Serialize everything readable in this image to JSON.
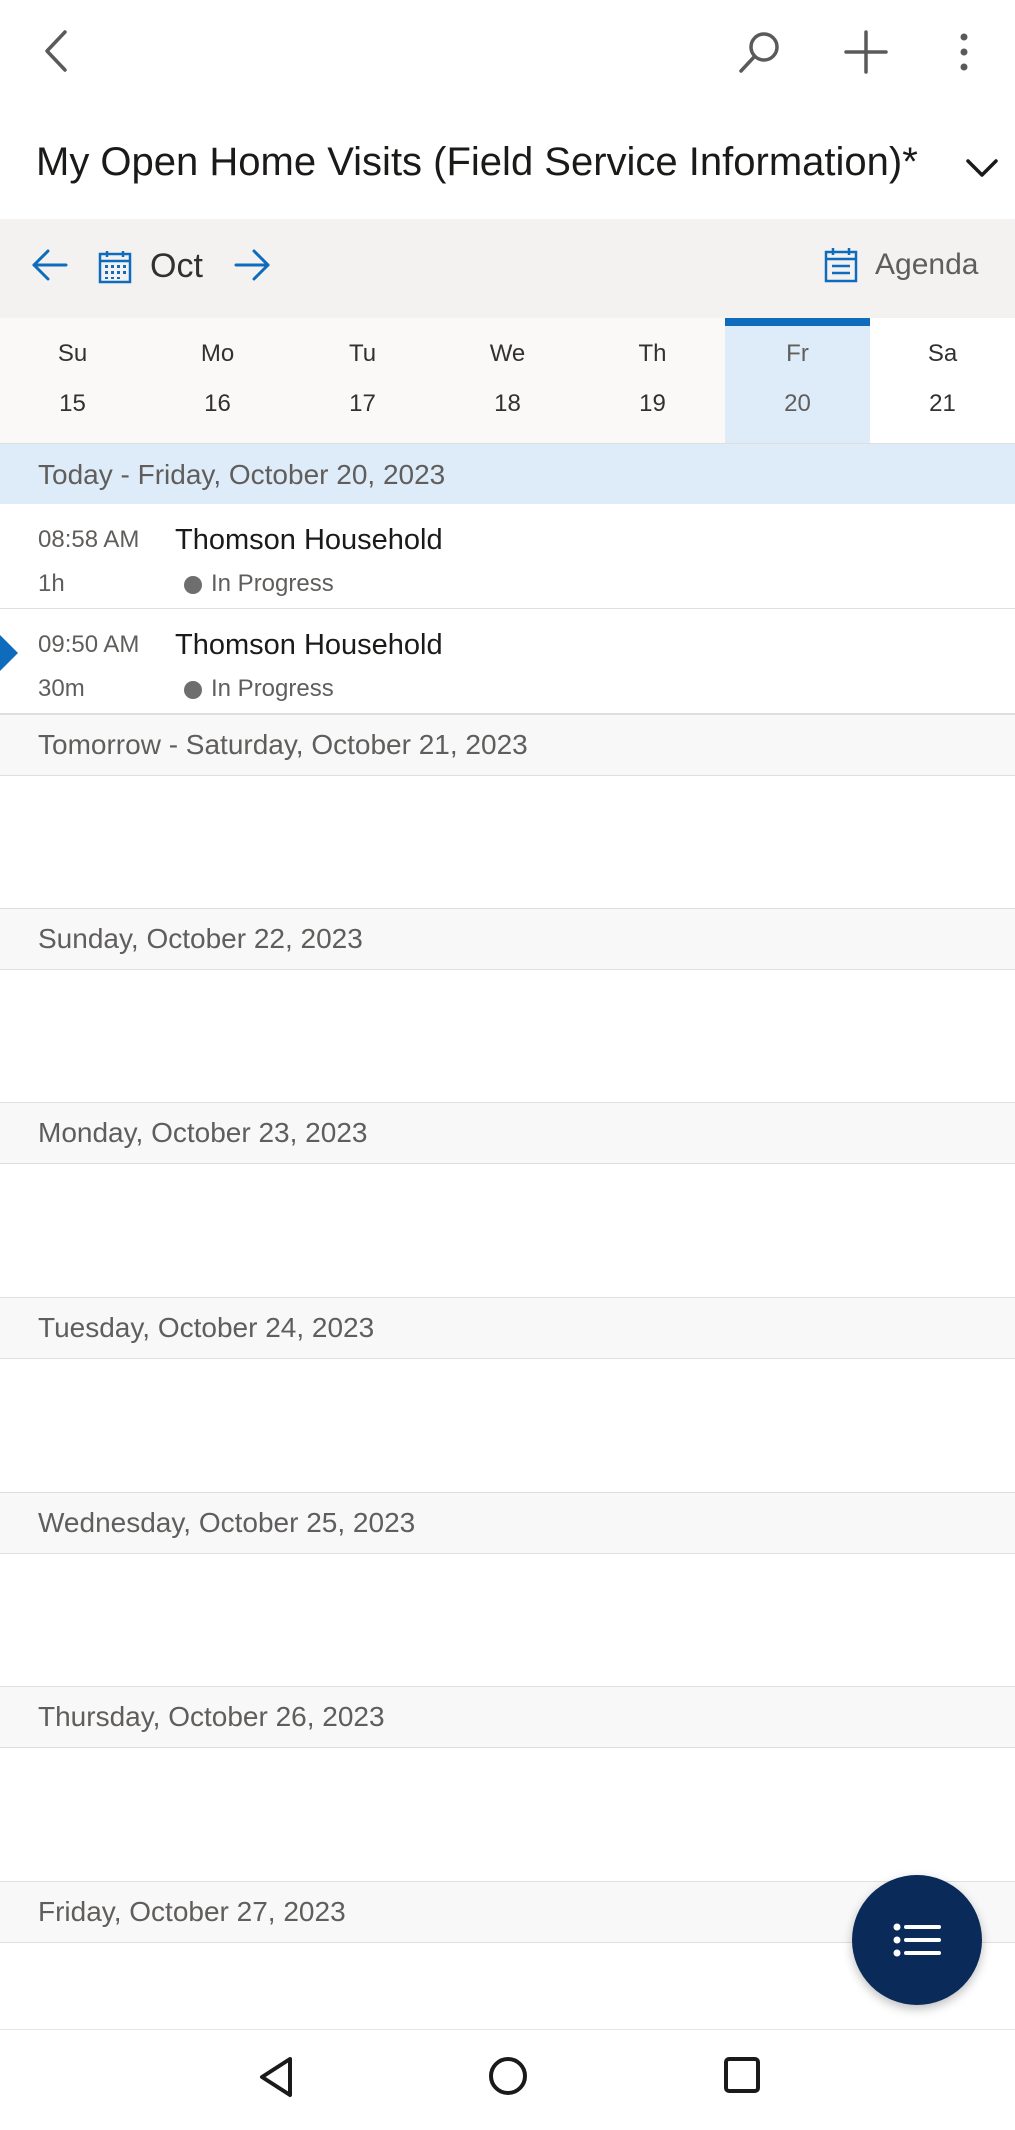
{
  "appbar": {
    "back_icon": "chevron-left-icon",
    "search_icon": "search-icon",
    "add_icon": "plus-icon",
    "more_icon": "more-vertical-icon"
  },
  "view": {
    "title": "My Open Home Visits (Field Service Information)*",
    "chevron_icon": "chevron-down-icon"
  },
  "calendar_nav": {
    "month": "Oct",
    "view_mode": "Agenda"
  },
  "week": [
    {
      "name": "Su",
      "date": "15"
    },
    {
      "name": "Mo",
      "date": "16"
    },
    {
      "name": "Tu",
      "date": "17"
    },
    {
      "name": "We",
      "date": "18"
    },
    {
      "name": "Th",
      "date": "19"
    },
    {
      "name": "Fr",
      "date": "20"
    },
    {
      "name": "Sa",
      "date": "21"
    }
  ],
  "agenda": {
    "days": [
      "Today - Friday, October 20, 2023",
      "Tomorrow - Saturday, October 21, 2023",
      "Sunday, October 22, 2023",
      "Monday, October 23, 2023",
      "Tuesday, October 24, 2023",
      "Wednesday, October 25, 2023",
      "Thursday, October 26, 2023",
      "Friday, October 27, 2023"
    ],
    "events": [
      {
        "time": "08:58 AM",
        "duration": "1h",
        "title": "Thomson Household",
        "status": "In Progress"
      },
      {
        "time": "09:50 AM",
        "duration": "30m",
        "title": "Thomson Household",
        "status": "In Progress"
      }
    ]
  },
  "colors": {
    "accent": "#0f6cbd",
    "fab": "#0a2a5a",
    "selected_day": "#deecf9"
  }
}
